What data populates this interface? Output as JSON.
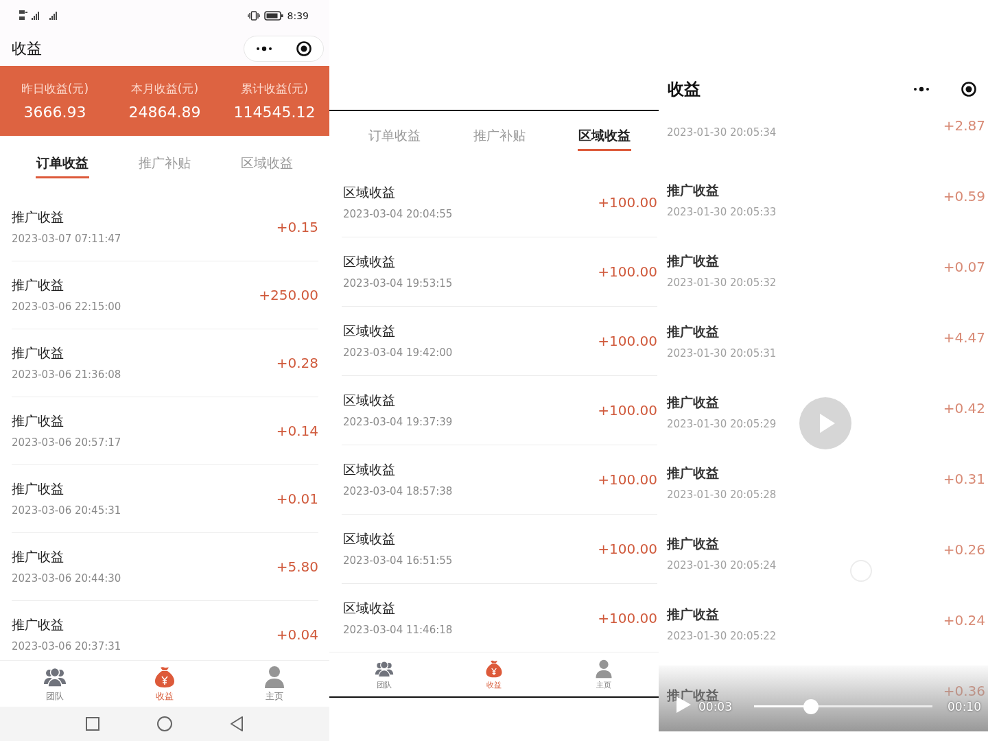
{
  "screen_1": {
    "status_bar": {
      "time": "8:39"
    },
    "title": "收益",
    "stats": [
      {
        "label": "昨日收益(元)",
        "value": "3666.93"
      },
      {
        "label": "本月收益(元)",
        "value": "24864.89"
      },
      {
        "label": "累计收益(元)",
        "value": "114545.12"
      }
    ],
    "tabs": [
      {
        "label": "订单收益",
        "selected": true
      },
      {
        "label": "推广补贴",
        "selected": false
      },
      {
        "label": "区域收益",
        "selected": false
      }
    ],
    "records": [
      {
        "title": "推广收益",
        "time": "2023-03-07 07:11:47",
        "amount": "+0.15"
      },
      {
        "title": "推广收益",
        "time": "2023-03-06 22:15:00",
        "amount": "+250.00"
      },
      {
        "title": "推广收益",
        "time": "2023-03-06 21:36:08",
        "amount": "+0.28"
      },
      {
        "title": "推广收益",
        "time": "2023-03-06 20:57:17",
        "amount": "+0.14"
      },
      {
        "title": "推广收益",
        "time": "2023-03-06 20:45:31",
        "amount": "+0.01"
      },
      {
        "title": "推广收益",
        "time": "2023-03-06 20:44:30",
        "amount": "+5.80"
      },
      {
        "title": "推广收益",
        "time": "2023-03-06 20:37:31",
        "amount": "+0.04"
      }
    ],
    "nav": [
      {
        "kind": "team",
        "label": "团队",
        "selected": false
      },
      {
        "kind": "income",
        "label": "收益",
        "selected": true
      },
      {
        "kind": "profile",
        "label": "主页",
        "selected": false
      }
    ]
  },
  "screen_2": {
    "tabs": [
      {
        "label": "订单收益",
        "selected": false
      },
      {
        "label": "推广补贴",
        "selected": false
      },
      {
        "label": "区域收益",
        "selected": true
      }
    ],
    "records": [
      {
        "title": "区域收益",
        "time": "2023-03-04 20:04:55",
        "amount": "+100.00"
      },
      {
        "title": "区域收益",
        "time": "2023-03-04 19:53:15",
        "amount": "+100.00"
      },
      {
        "title": "区域收益",
        "time": "2023-03-04 19:42:00",
        "amount": "+100.00"
      },
      {
        "title": "区域收益",
        "time": "2023-03-04 19:37:39",
        "amount": "+100.00"
      },
      {
        "title": "区域收益",
        "time": "2023-03-04 18:57:38",
        "amount": "+100.00"
      },
      {
        "title": "区域收益",
        "time": "2023-03-04 16:51:55",
        "amount": "+100.00"
      },
      {
        "title": "区域收益",
        "time": "2023-03-04 11:46:18",
        "amount": "+100.00"
      }
    ],
    "nav": [
      {
        "kind": "team",
        "label": "团队",
        "selected": false
      },
      {
        "kind": "income",
        "label": "收益",
        "selected": true
      },
      {
        "kind": "profile",
        "label": "主页",
        "selected": false
      }
    ]
  },
  "screen_3": {
    "title": "收益",
    "records": [
      {
        "time": "2023-01-30 20:05:34",
        "amount": "+2.87"
      },
      {
        "title": "推广收益",
        "time": "2023-01-30 20:05:33",
        "amount": "+0.59"
      },
      {
        "title": "推广收益",
        "time": "2023-01-30 20:05:32",
        "amount": "+0.07"
      },
      {
        "title": "推广收益",
        "time": "2023-01-30 20:05:31",
        "amount": "+4.47"
      },
      {
        "title": "推广收益",
        "time": "2023-01-30 20:05:29",
        "amount": "+0.42"
      },
      {
        "title": "推广收益",
        "time": "2023-01-30 20:05:28",
        "amount": "+0.31"
      },
      {
        "title": "推广收益",
        "time": "2023-01-30 20:05:24",
        "amount": "+0.26"
      },
      {
        "title": "推广收益",
        "time": "2023-01-30 20:05:22",
        "amount": "+0.24"
      },
      {
        "title": "推广收益",
        "amount": "+0.36"
      }
    ],
    "video": {
      "current": "00:03",
      "duration": "00:10",
      "level": 0.32
    }
  }
}
